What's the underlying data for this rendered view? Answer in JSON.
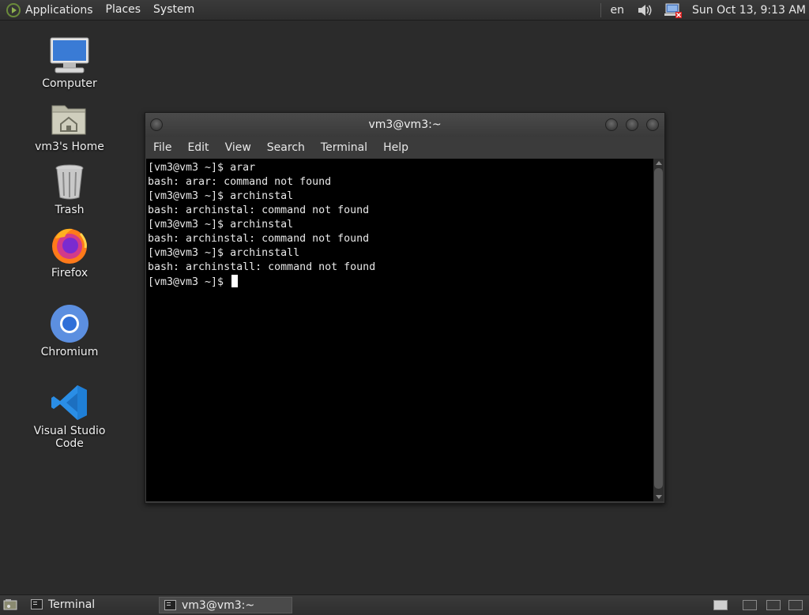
{
  "top_panel": {
    "menus": [
      "Applications",
      "Places",
      "System"
    ],
    "language": "en",
    "clock": "Sun Oct 13,  9:13 AM",
    "icons": [
      "distro-logo-icon",
      "volume-icon",
      "network-icon"
    ]
  },
  "desktop": {
    "icons": [
      {
        "label": "Computer",
        "icon": "computer-icon"
      },
      {
        "label": "vm3's Home",
        "icon": "home-folder-icon"
      },
      {
        "label": "Trash",
        "icon": "trash-icon"
      },
      {
        "label": "Firefox",
        "icon": "firefox-icon"
      },
      {
        "label": "Chromium",
        "icon": "chromium-icon"
      },
      {
        "label": "Visual Studio Code",
        "icon": "vscode-icon"
      }
    ]
  },
  "window": {
    "title": "vm3@vm3:~",
    "menus": [
      "File",
      "Edit",
      "View",
      "Search",
      "Terminal",
      "Help"
    ],
    "lines": [
      "[vm3@vm3 ~]$ arar",
      "bash: arar: command not found",
      "[vm3@vm3 ~]$ archinstal",
      "bash: archinstal: command not found",
      "[vm3@vm3 ~]$ archinstal",
      "bash: archinstal: command not found",
      "[vm3@vm3 ~]$ archinstall",
      "bash: archinstall: command not found"
    ],
    "prompt": "[vm3@vm3 ~]$ "
  },
  "bottom_panel": {
    "tasks": [
      {
        "label": "Terminal",
        "active": false
      },
      {
        "label": "vm3@vm3:~",
        "active": true
      }
    ]
  }
}
